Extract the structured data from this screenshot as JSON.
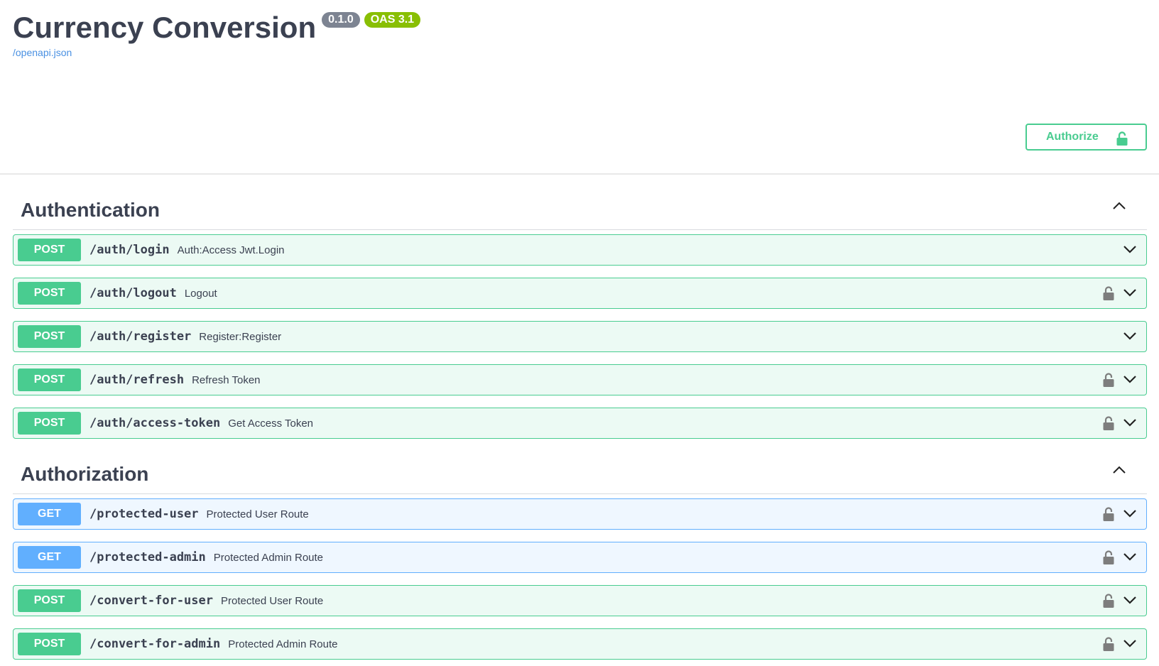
{
  "info": {
    "title": "Currency Conversion",
    "version": "0.1.0",
    "oas": "OAS 3.1",
    "spec_link": "/openapi.json"
  },
  "authorize": {
    "label": "Authorize"
  },
  "colors": {
    "post": "#49cc90",
    "get": "#61affe",
    "text": "#3b4151",
    "link": "#4990e2",
    "lock": "#7d7d7d"
  },
  "sections": [
    {
      "title": "Authentication",
      "operations": [
        {
          "method": "POST",
          "path": "/auth/login",
          "summary": "Auth:Access Jwt.Login",
          "locked": false
        },
        {
          "method": "POST",
          "path": "/auth/logout",
          "summary": "Logout",
          "locked": true
        },
        {
          "method": "POST",
          "path": "/auth/register",
          "summary": "Register:Register",
          "locked": false
        },
        {
          "method": "POST",
          "path": "/auth/refresh",
          "summary": "Refresh Token",
          "locked": true
        },
        {
          "method": "POST",
          "path": "/auth/access-token",
          "summary": "Get Access Token",
          "locked": true
        }
      ]
    },
    {
      "title": "Authorization",
      "operations": [
        {
          "method": "GET",
          "path": "/protected-user",
          "summary": "Protected User Route",
          "locked": true
        },
        {
          "method": "GET",
          "path": "/protected-admin",
          "summary": "Protected Admin Route",
          "locked": true
        },
        {
          "method": "POST",
          "path": "/convert-for-user",
          "summary": "Protected User Route",
          "locked": true
        },
        {
          "method": "POST",
          "path": "/convert-for-admin",
          "summary": "Protected Admin Route",
          "locked": true
        }
      ]
    }
  ]
}
